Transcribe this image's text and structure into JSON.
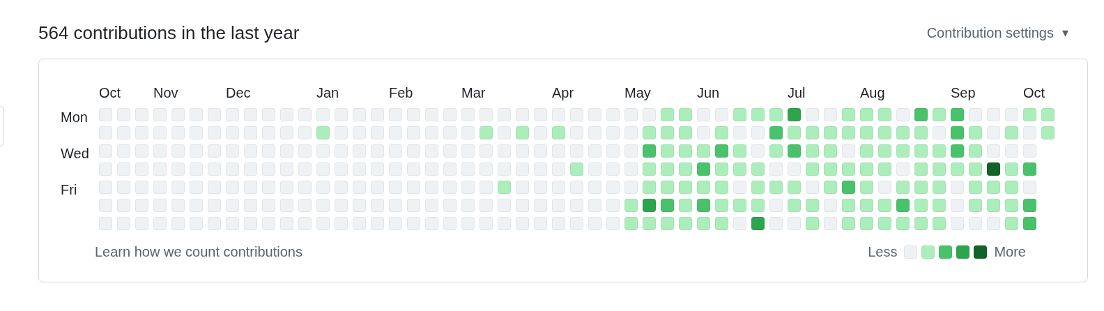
{
  "title": "564 contributions in the last year",
  "settings": {
    "label": "Contribution settings",
    "caret": "▾"
  },
  "day_labels": [
    "Mon",
    "Wed",
    "Fri"
  ],
  "weeks": [
    {
      "month": "Oct",
      "days": [
        {
          "color": "#eff2f5"
        },
        {
          "color": "#eff2f5"
        },
        {
          "color": "#eff2f5"
        },
        {
          "color": "#eff2f5"
        },
        {
          "color": "#eff2f5"
        },
        {
          "color": "#eff2f5"
        },
        {
          "color": "#eff2f5"
        }
      ]
    },
    {
      "days": [
        {
          "color": "#eff2f5"
        },
        {
          "color": "#eff2f5"
        },
        {
          "color": "#eff2f5"
        },
        {
          "color": "#eff2f5"
        },
        {
          "color": "#eff2f5"
        },
        {
          "color": "#eff2f5"
        },
        {
          "color": "#eff2f5"
        }
      ]
    },
    {
      "days": [
        {
          "color": "#eff2f5"
        },
        {
          "color": "#eff2f5"
        },
        {
          "color": "#eff2f5"
        },
        {
          "color": "#eff2f5"
        },
        {
          "color": "#eff2f5"
        },
        {
          "color": "#eff2f5"
        },
        {
          "color": "#eff2f5"
        }
      ]
    },
    {
      "month": "Nov",
      "days": [
        {
          "color": "#eff2f5"
        },
        {
          "color": "#eff2f5"
        },
        {
          "color": "#eff2f5"
        },
        {
          "color": "#eff2f5"
        },
        {
          "color": "#eff2f5"
        },
        {
          "color": "#eff2f5"
        },
        {
          "color": "#eff2f5"
        }
      ]
    },
    {
      "days": [
        {
          "color": "#eff2f5"
        },
        {
          "color": "#eff2f5"
        },
        {
          "color": "#eff2f5"
        },
        {
          "color": "#eff2f5"
        },
        {
          "color": "#eff2f5"
        },
        {
          "color": "#eff2f5"
        },
        {
          "color": "#eff2f5"
        }
      ]
    },
    {
      "days": [
        {
          "color": "#eff2f5"
        },
        {
          "color": "#eff2f5"
        },
        {
          "color": "#eff2f5"
        },
        {
          "color": "#eff2f5"
        },
        {
          "color": "#eff2f5"
        },
        {
          "color": "#eff2f5"
        },
        {
          "color": "#eff2f5"
        }
      ]
    },
    {
      "days": [
        {
          "color": "#eff2f5"
        },
        {
          "color": "#eff2f5"
        },
        {
          "color": "#eff2f5"
        },
        {
          "color": "#eff2f5"
        },
        {
          "color": "#eff2f5"
        },
        {
          "color": "#eff2f5"
        },
        {
          "color": "#eff2f5"
        }
      ]
    },
    {
      "month": "Dec",
      "days": [
        {
          "color": "#eff2f5"
        },
        {
          "color": "#eff2f5"
        },
        {
          "color": "#eff2f5"
        },
        {
          "color": "#eff2f5"
        },
        {
          "color": "#eff2f5"
        },
        {
          "color": "#eff2f5"
        },
        {
          "color": "#eff2f5"
        }
      ]
    },
    {
      "days": [
        {
          "color": "#eff2f5"
        },
        {
          "color": "#eff2f5"
        },
        {
          "color": "#eff2f5"
        },
        {
          "color": "#eff2f5"
        },
        {
          "color": "#eff2f5"
        },
        {
          "color": "#eff2f5"
        },
        {
          "color": "#eff2f5"
        }
      ]
    },
    {
      "days": [
        {
          "color": "#eff2f5"
        },
        {
          "color": "#eff2f5"
        },
        {
          "color": "#eff2f5"
        },
        {
          "color": "#eff2f5"
        },
        {
          "color": "#eff2f5"
        },
        {
          "color": "#eff2f5"
        },
        {
          "color": "#eff2f5"
        }
      ]
    },
    {
      "days": [
        {
          "color": "#eff2f5"
        },
        {
          "color": "#eff2f5"
        },
        {
          "color": "#eff2f5"
        },
        {
          "color": "#eff2f5"
        },
        {
          "color": "#eff2f5"
        },
        {
          "color": "#eff2f5"
        },
        {
          "color": "#eff2f5"
        }
      ]
    },
    {
      "days": [
        {
          "color": "#eff2f5"
        },
        {
          "color": "#eff2f5"
        },
        {
          "color": "#eff2f5"
        },
        {
          "color": "#eff2f5"
        },
        {
          "color": "#eff2f5"
        },
        {
          "color": "#eff2f5"
        },
        {
          "color": "#eff2f5"
        }
      ]
    },
    {
      "month": "Jan",
      "days": [
        {
          "color": "#eff2f5"
        },
        {
          "color": "#aceebb"
        },
        {
          "color": "#eff2f5"
        },
        {
          "color": "#eff2f5"
        },
        {
          "color": "#eff2f5"
        },
        {
          "color": "#eff2f5"
        },
        {
          "color": "#eff2f5"
        }
      ]
    },
    {
      "days": [
        {
          "color": "#eff2f5"
        },
        {
          "color": "#eff2f5"
        },
        {
          "color": "#eff2f5"
        },
        {
          "color": "#eff2f5"
        },
        {
          "color": "#eff2f5"
        },
        {
          "color": "#eff2f5"
        },
        {
          "color": "#eff2f5"
        }
      ]
    },
    {
      "days": [
        {
          "color": "#eff2f5"
        },
        {
          "color": "#eff2f5"
        },
        {
          "color": "#eff2f5"
        },
        {
          "color": "#eff2f5"
        },
        {
          "color": "#eff2f5"
        },
        {
          "color": "#eff2f5"
        },
        {
          "color": "#eff2f5"
        }
      ]
    },
    {
      "days": [
        {
          "color": "#eff2f5"
        },
        {
          "color": "#eff2f5"
        },
        {
          "color": "#eff2f5"
        },
        {
          "color": "#eff2f5"
        },
        {
          "color": "#eff2f5"
        },
        {
          "color": "#eff2f5"
        },
        {
          "color": "#eff2f5"
        }
      ]
    },
    {
      "month": "Feb",
      "days": [
        {
          "color": "#eff2f5"
        },
        {
          "color": "#eff2f5"
        },
        {
          "color": "#eff2f5"
        },
        {
          "color": "#eff2f5"
        },
        {
          "color": "#eff2f5"
        },
        {
          "color": "#eff2f5"
        },
        {
          "color": "#eff2f5"
        }
      ]
    },
    {
      "days": [
        {
          "color": "#eff2f5"
        },
        {
          "color": "#eff2f5"
        },
        {
          "color": "#eff2f5"
        },
        {
          "color": "#eff2f5"
        },
        {
          "color": "#eff2f5"
        },
        {
          "color": "#eff2f5"
        },
        {
          "color": "#eff2f5"
        }
      ]
    },
    {
      "days": [
        {
          "color": "#eff2f5"
        },
        {
          "color": "#eff2f5"
        },
        {
          "color": "#eff2f5"
        },
        {
          "color": "#eff2f5"
        },
        {
          "color": "#eff2f5"
        },
        {
          "color": "#eff2f5"
        },
        {
          "color": "#eff2f5"
        }
      ]
    },
    {
      "days": [
        {
          "color": "#eff2f5"
        },
        {
          "color": "#eff2f5"
        },
        {
          "color": "#eff2f5"
        },
        {
          "color": "#eff2f5"
        },
        {
          "color": "#eff2f5"
        },
        {
          "color": "#eff2f5"
        },
        {
          "color": "#eff2f5"
        }
      ]
    },
    {
      "month": "Mar",
      "days": [
        {
          "color": "#eff2f5"
        },
        {
          "color": "#eff2f5"
        },
        {
          "color": "#eff2f5"
        },
        {
          "color": "#eff2f5"
        },
        {
          "color": "#eff2f5"
        },
        {
          "color": "#eff2f5"
        },
        {
          "color": "#eff2f5"
        }
      ]
    },
    {
      "days": [
        {
          "color": "#eff2f5"
        },
        {
          "color": "#aceebb"
        },
        {
          "color": "#eff2f5"
        },
        {
          "color": "#eff2f5"
        },
        {
          "color": "#eff2f5"
        },
        {
          "color": "#eff2f5"
        },
        {
          "color": "#eff2f5"
        }
      ]
    },
    {
      "days": [
        {
          "color": "#eff2f5"
        },
        {
          "color": "#eff2f5"
        },
        {
          "color": "#eff2f5"
        },
        {
          "color": "#eff2f5"
        },
        {
          "color": "#aceebb"
        },
        {
          "color": "#eff2f5"
        },
        {
          "color": "#eff2f5"
        }
      ]
    },
    {
      "days": [
        {
          "color": "#eff2f5"
        },
        {
          "color": "#aceebb"
        },
        {
          "color": "#eff2f5"
        },
        {
          "color": "#eff2f5"
        },
        {
          "color": "#eff2f5"
        },
        {
          "color": "#eff2f5"
        },
        {
          "color": "#eff2f5"
        }
      ]
    },
    {
      "days": [
        {
          "color": "#eff2f5"
        },
        {
          "color": "#eff2f5"
        },
        {
          "color": "#eff2f5"
        },
        {
          "color": "#eff2f5"
        },
        {
          "color": "#eff2f5"
        },
        {
          "color": "#eff2f5"
        },
        {
          "color": "#eff2f5"
        }
      ]
    },
    {
      "month": "Apr",
      "days": [
        {
          "color": "#eff2f5"
        },
        {
          "color": "#aceebb"
        },
        {
          "color": "#eff2f5"
        },
        {
          "color": "#eff2f5"
        },
        {
          "color": "#eff2f5"
        },
        {
          "color": "#eff2f5"
        },
        {
          "color": "#eff2f5"
        }
      ]
    },
    {
      "days": [
        {
          "color": "#eff2f5"
        },
        {
          "color": "#eff2f5"
        },
        {
          "color": "#eff2f5"
        },
        {
          "color": "#aceebb"
        },
        {
          "color": "#eff2f5"
        },
        {
          "color": "#eff2f5"
        },
        {
          "color": "#eff2f5"
        }
      ]
    },
    {
      "days": [
        {
          "color": "#eff2f5"
        },
        {
          "color": "#eff2f5"
        },
        {
          "color": "#eff2f5"
        },
        {
          "color": "#eff2f5"
        },
        {
          "color": "#eff2f5"
        },
        {
          "color": "#eff2f5"
        },
        {
          "color": "#eff2f5"
        }
      ]
    },
    {
      "days": [
        {
          "color": "#eff2f5"
        },
        {
          "color": "#eff2f5"
        },
        {
          "color": "#eff2f5"
        },
        {
          "color": "#eff2f5"
        },
        {
          "color": "#eff2f5"
        },
        {
          "color": "#eff2f5"
        },
        {
          "color": "#eff2f5"
        }
      ]
    },
    {
      "month": "May",
      "days": [
        {
          "color": "#eff2f5"
        },
        {
          "color": "#eff2f5"
        },
        {
          "color": "#eff2f5"
        },
        {
          "color": "#eff2f5"
        },
        {
          "color": "#eff2f5"
        },
        {
          "color": "#aceebb"
        },
        {
          "color": "#aceebb"
        }
      ]
    },
    {
      "days": [
        {
          "color": "#eff2f5"
        },
        {
          "color": "#aceebb"
        },
        {
          "color": "#4ac26b"
        },
        {
          "color": "#aceebb"
        },
        {
          "color": "#aceebb"
        },
        {
          "color": "#2da44e"
        },
        {
          "color": "#aceebb"
        }
      ]
    },
    {
      "days": [
        {
          "color": "#aceebb"
        },
        {
          "color": "#aceebb"
        },
        {
          "color": "#aceebb"
        },
        {
          "color": "#aceebb"
        },
        {
          "color": "#aceebb"
        },
        {
          "color": "#4ac26b"
        },
        {
          "color": "#aceebb"
        }
      ]
    },
    {
      "days": [
        {
          "color": "#aceebb"
        },
        {
          "color": "#aceebb"
        },
        {
          "color": "#aceebb"
        },
        {
          "color": "#aceebb"
        },
        {
          "color": "#aceebb"
        },
        {
          "color": "#aceebb"
        },
        {
          "color": "#aceebb"
        }
      ]
    },
    {
      "month": "Jun",
      "days": [
        {
          "color": "#eff2f5"
        },
        {
          "color": "#eff2f5"
        },
        {
          "color": "#aceebb"
        },
        {
          "color": "#4ac26b"
        },
        {
          "color": "#aceebb"
        },
        {
          "color": "#4ac26b"
        },
        {
          "color": "#aceebb"
        }
      ]
    },
    {
      "days": [
        {
          "color": "#eff2f5"
        },
        {
          "color": "#aceebb"
        },
        {
          "color": "#4ac26b"
        },
        {
          "color": "#aceebb"
        },
        {
          "color": "#aceebb"
        },
        {
          "color": "#aceebb"
        },
        {
          "color": "#aceebb"
        }
      ]
    },
    {
      "days": [
        {
          "color": "#aceebb"
        },
        {
          "color": "#eff2f5"
        },
        {
          "color": "#aceebb"
        },
        {
          "color": "#aceebb"
        },
        {
          "color": "#eff2f5"
        },
        {
          "color": "#aceebb"
        },
        {
          "color": "#eff2f5"
        }
      ]
    },
    {
      "days": [
        {
          "color": "#aceebb"
        },
        {
          "color": "#eff2f5"
        },
        {
          "color": "#eff2f5"
        },
        {
          "color": "#aceebb"
        },
        {
          "color": "#aceebb"
        },
        {
          "color": "#aceebb"
        },
        {
          "color": "#2da44e"
        }
      ]
    },
    {
      "days": [
        {
          "color": "#aceebb"
        },
        {
          "color": "#4ac26b"
        },
        {
          "color": "#aceebb"
        },
        {
          "color": "#eff2f5"
        },
        {
          "color": "#aceebb"
        },
        {
          "color": "#eff2f5"
        },
        {
          "color": "#eff2f5"
        }
      ]
    },
    {
      "month": "Jul",
      "days": [
        {
          "color": "#2da44e"
        },
        {
          "color": "#aceebb"
        },
        {
          "color": "#4ac26b"
        },
        {
          "color": "#eff2f5"
        },
        {
          "color": "#aceebb"
        },
        {
          "color": "#aceebb"
        },
        {
          "color": "#eff2f5"
        }
      ]
    },
    {
      "days": [
        {
          "color": "#eff2f5"
        },
        {
          "color": "#aceebb"
        },
        {
          "color": "#aceebb"
        },
        {
          "color": "#aceebb"
        },
        {
          "color": "#eff2f5"
        },
        {
          "color": "#aceebb"
        },
        {
          "color": "#aceebb"
        }
      ]
    },
    {
      "days": [
        {
          "color": "#eff2f5"
        },
        {
          "color": "#aceebb"
        },
        {
          "color": "#aceebb"
        },
        {
          "color": "#aceebb"
        },
        {
          "color": "#aceebb"
        },
        {
          "color": "#eff2f5"
        },
        {
          "color": "#eff2f5"
        }
      ]
    },
    {
      "days": [
        {
          "color": "#aceebb"
        },
        {
          "color": "#aceebb"
        },
        {
          "color": "#eff2f5"
        },
        {
          "color": "#aceebb"
        },
        {
          "color": "#4ac26b"
        },
        {
          "color": "#aceebb"
        },
        {
          "color": "#aceebb"
        }
      ]
    },
    {
      "month": "Aug",
      "days": [
        {
          "color": "#aceebb"
        },
        {
          "color": "#aceebb"
        },
        {
          "color": "#aceebb"
        },
        {
          "color": "#aceebb"
        },
        {
          "color": "#aceebb"
        },
        {
          "color": "#aceebb"
        },
        {
          "color": "#aceebb"
        }
      ]
    },
    {
      "days": [
        {
          "color": "#aceebb"
        },
        {
          "color": "#aceebb"
        },
        {
          "color": "#aceebb"
        },
        {
          "color": "#aceebb"
        },
        {
          "color": "#eff2f5"
        },
        {
          "color": "#aceebb"
        },
        {
          "color": "#aceebb"
        }
      ]
    },
    {
      "days": [
        {
          "color": "#eff2f5"
        },
        {
          "color": "#aceebb"
        },
        {
          "color": "#aceebb"
        },
        {
          "color": "#eff2f5"
        },
        {
          "color": "#aceebb"
        },
        {
          "color": "#4ac26b"
        },
        {
          "color": "#aceebb"
        }
      ]
    },
    {
      "days": [
        {
          "color": "#4ac26b"
        },
        {
          "color": "#aceebb"
        },
        {
          "color": "#aceebb"
        },
        {
          "color": "#aceebb"
        },
        {
          "color": "#aceebb"
        },
        {
          "color": "#aceebb"
        },
        {
          "color": "#aceebb"
        }
      ]
    },
    {
      "days": [
        {
          "color": "#aceebb"
        },
        {
          "color": "#eff2f5"
        },
        {
          "color": "#aceebb"
        },
        {
          "color": "#aceebb"
        },
        {
          "color": "#aceebb"
        },
        {
          "color": "#aceebb"
        },
        {
          "color": "#aceebb"
        }
      ]
    },
    {
      "month": "Sep",
      "days": [
        {
          "color": "#4ac26b"
        },
        {
          "color": "#4ac26b"
        },
        {
          "color": "#4ac26b"
        },
        {
          "color": "#aceebb"
        },
        {
          "color": "#eff2f5"
        },
        {
          "color": "#eff2f5"
        },
        {
          "color": "#eff2f5"
        }
      ]
    },
    {
      "days": [
        {
          "color": "#eff2f5"
        },
        {
          "color": "#aceebb"
        },
        {
          "color": "#aceebb"
        },
        {
          "color": "#aceebb"
        },
        {
          "color": "#aceebb"
        },
        {
          "color": "#aceebb"
        },
        {
          "color": "#eff2f5"
        }
      ]
    },
    {
      "days": [
        {
          "color": "#eff2f5"
        },
        {
          "color": "#eff2f5"
        },
        {
          "color": "#eff2f5"
        },
        {
          "color": "#116329"
        },
        {
          "color": "#aceebb"
        },
        {
          "color": "#aceebb"
        },
        {
          "color": "#eff2f5"
        }
      ]
    },
    {
      "days": [
        {
          "color": "#eff2f5"
        },
        {
          "color": "#aceebb"
        },
        {
          "color": "#eff2f5"
        },
        {
          "color": "#aceebb"
        },
        {
          "color": "#aceebb"
        },
        {
          "color": "#aceebb"
        },
        {
          "color": "#aceebb"
        }
      ]
    },
    {
      "month": "Oct",
      "days": [
        {
          "color": "#aceebb"
        },
        {
          "color": "#eff2f5"
        },
        {
          "color": "#eff2f5"
        },
        {
          "color": "#4ac26b"
        },
        {
          "color": "#eff2f5"
        },
        {
          "color": "#4ac26b"
        },
        {
          "color": "#4ac26b"
        }
      ]
    },
    {
      "days": [
        {
          "color": "#aceebb"
        },
        {
          "color": "#aceebb"
        }
      ]
    }
  ],
  "footer_link": "Learn how we count contributions",
  "legend": {
    "less": "Less",
    "more": "More",
    "swatches": [
      {
        "color": "#eff2f5"
      },
      {
        "color": "#aceebb"
      },
      {
        "color": "#4ac26b"
      },
      {
        "color": "#2da44e"
      },
      {
        "color": "#116329"
      }
    ]
  }
}
